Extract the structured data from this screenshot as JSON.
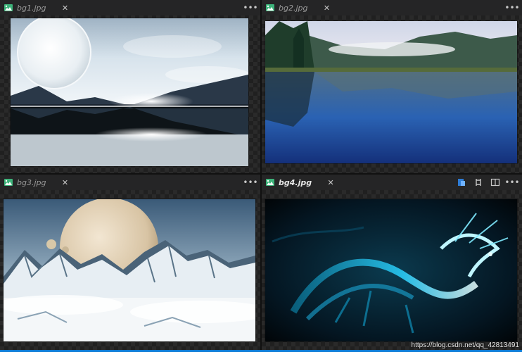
{
  "panes": [
    {
      "tab": "bg1.jpg",
      "active": false
    },
    {
      "tab": "bg2.jpg",
      "active": false
    },
    {
      "tab": "bg3.jpg",
      "active": false
    },
    {
      "tab": "bg4.jpg",
      "active": true
    }
  ],
  "icons": {
    "image_file": "image-icon",
    "close": "close-icon",
    "more": "more-icon",
    "open_file": "open-file-icon",
    "compare": "compare-icon",
    "split": "split-editor-icon"
  },
  "glyphs": {
    "close": "✕",
    "more": "•••"
  },
  "watermark": "https://blog.csdn.net/qq_42813491",
  "colors": {
    "accent": "#0e7cd6",
    "image_icon": "#3db37a"
  }
}
